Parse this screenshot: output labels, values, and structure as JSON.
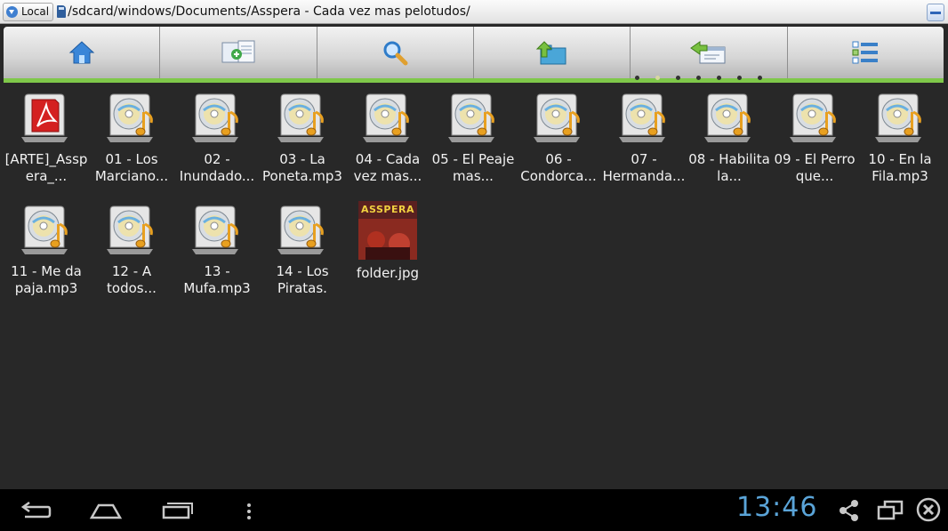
{
  "pathbar": {
    "location_label": "Local",
    "path": "/sdcard/windows/Documents/Asspera - Cada vez mas pelotudos/"
  },
  "toolbar": {
    "buttons": [
      {
        "icon": "home-icon"
      },
      {
        "icon": "copy-add-icon"
      },
      {
        "icon": "search-icon"
      },
      {
        "icon": "folder-up-icon"
      },
      {
        "icon": "window-back-icon"
      },
      {
        "icon": "list-view-icon"
      }
    ],
    "page_indicator_count": 7,
    "page_indicator_active": 1
  },
  "files": [
    {
      "name": "[ARTE]_Asspera_...",
      "icon": "pdf-icon"
    },
    {
      "name": "01 - Los Marciano...",
      "icon": "audio-file-icon"
    },
    {
      "name": "02 - Inundado...",
      "icon": "audio-file-icon"
    },
    {
      "name": "03 - La Poneta.mp3",
      "icon": "audio-file-icon"
    },
    {
      "name": "04 - Cada vez mas...",
      "icon": "audio-file-icon"
    },
    {
      "name": "05 - El Peaje mas...",
      "icon": "audio-file-icon"
    },
    {
      "name": "06 - Condorca...",
      "icon": "audio-file-icon"
    },
    {
      "name": "07 - Hermanda...",
      "icon": "audio-file-icon"
    },
    {
      "name": "08 - Habilita la...",
      "icon": "audio-file-icon"
    },
    {
      "name": "09 - El Perro que...",
      "icon": "audio-file-icon"
    },
    {
      "name": "10 - En la Fila.mp3",
      "icon": "audio-file-icon"
    },
    {
      "name": "11 - Me da paja.mp3",
      "icon": "audio-file-icon"
    },
    {
      "name": "12 - A todos...",
      "icon": "audio-file-icon"
    },
    {
      "name": "13 - Mufa.mp3",
      "icon": "audio-file-icon"
    },
    {
      "name": "14 - Los Piratas.",
      "icon": "audio-file-icon"
    },
    {
      "name": "folder.jpg",
      "icon": "image-thumbnail",
      "thumb_text": "ASSPERA"
    }
  ],
  "statusbar": {
    "time": "13:46"
  },
  "colors": {
    "accent_green": "#7fc84a",
    "clock_blue": "#5aa4d8",
    "background": "#282828"
  }
}
